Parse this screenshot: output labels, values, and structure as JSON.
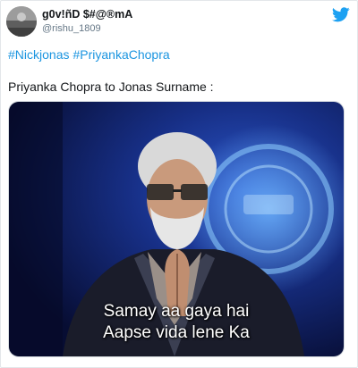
{
  "tweet": {
    "author": {
      "display_name": "g0v!ñD $#@®mA",
      "handle": "@rishu_1809",
      "avatar_icon": "user-avatar"
    },
    "platform_icon": "twitter-bird-icon",
    "hashtags": [
      "#Nickjonas",
      "#PriyankaChopra"
    ],
    "text": "Priyanka Chopra to Jonas Surname :",
    "media": {
      "caption_line1": "Samay aa gaya hai",
      "caption_line2": "Aapse vida lene Ka"
    }
  },
  "colors": {
    "link": "#1b95e0",
    "twitter_blue": "#1da1f2",
    "text": "#14171a",
    "muted": "#657786"
  }
}
